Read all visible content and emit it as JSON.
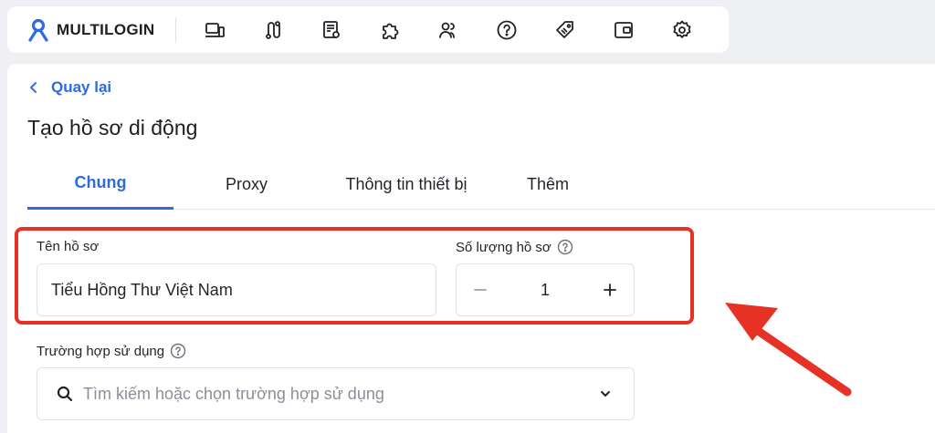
{
  "brand": {
    "name": "MULTILOGIN",
    "color": "#2f6bde"
  },
  "nav": {
    "icons": [
      "profiles-icon",
      "routes-icon",
      "templates-icon",
      "extensions-icon",
      "team-icon",
      "help-icon",
      "tags-icon",
      "wallet-icon",
      "settings-icon"
    ]
  },
  "header": {
    "back_label": "Quay lại",
    "title": "Tạo hồ sơ di động"
  },
  "tabs": [
    {
      "label": "Chung",
      "active": true
    },
    {
      "label": "Proxy",
      "active": false
    },
    {
      "label": "Thông tin thiết bị",
      "active": false
    },
    {
      "label": "Thêm",
      "active": false
    }
  ],
  "form": {
    "profile_name": {
      "label": "Tên hồ sơ",
      "value": "Tiểu Hồng Thư Việt Nam"
    },
    "profile_count": {
      "label": "Số lượng hồ sơ",
      "value": "1"
    },
    "use_case": {
      "label": "Trường hợp sử dụng",
      "placeholder": "Tìm kiếm hoặc chọn trường hợp sử dụng"
    }
  },
  "colors": {
    "highlight": "#e53224",
    "arrow": "#e53224",
    "accent": "#2f6bde"
  }
}
